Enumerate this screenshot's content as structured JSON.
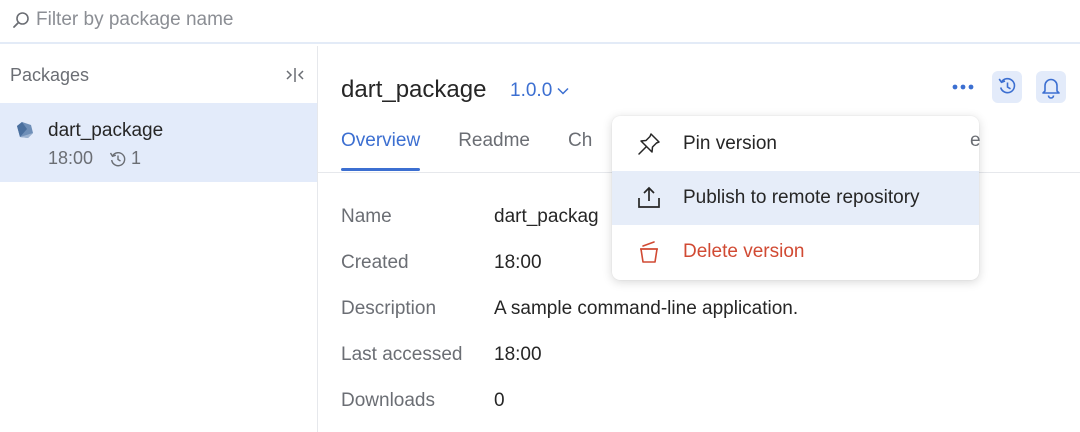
{
  "filter": {
    "placeholder": "Filter by package name",
    "value": ""
  },
  "sidebar": {
    "header": "Packages",
    "items": [
      {
        "name": "dart_package",
        "time": "18:00",
        "versions": "1"
      }
    ]
  },
  "package": {
    "name": "dart_package",
    "version": "1.0.0",
    "tabs": [
      "Overview",
      "Readme",
      "Ch",
      "e"
    ],
    "active_tab": "Overview",
    "properties": [
      {
        "key": "Name",
        "value": "dart_packag"
      },
      {
        "key": "Created",
        "value": "18:00"
      },
      {
        "key": "Description",
        "value": "A sample command-line application."
      },
      {
        "key": "Last accessed",
        "value": "18:00"
      },
      {
        "key": "Downloads",
        "value": "0"
      }
    ]
  },
  "menu": {
    "items": [
      {
        "label": "Pin version",
        "icon": "pin-icon"
      },
      {
        "label": "Publish to remote repository",
        "icon": "upload-icon"
      },
      {
        "label": "Delete version",
        "icon": "trash-icon"
      }
    ]
  },
  "colors": {
    "accent": "#3c6fd1",
    "selected_bg": "#e3ebfa",
    "danger": "#d14a33",
    "muted": "#6b6e74"
  }
}
